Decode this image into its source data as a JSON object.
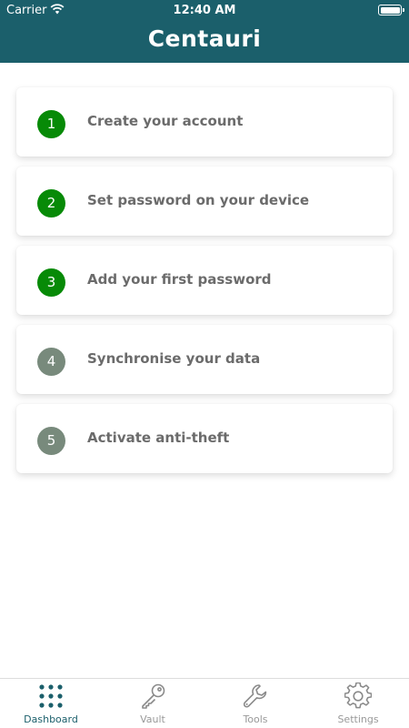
{
  "status_bar": {
    "carrier": "Carrier",
    "time": "12:40 AM"
  },
  "header": {
    "title": "Centauri"
  },
  "steps": [
    {
      "number": "1",
      "label": "Create your account",
      "completed": true
    },
    {
      "number": "2",
      "label": "Set password on your device",
      "completed": true
    },
    {
      "number": "3",
      "label": "Add your first password",
      "completed": true
    },
    {
      "number": "4",
      "label": "Synchronise your data",
      "completed": false
    },
    {
      "number": "5",
      "label": "Activate anti-theft",
      "completed": false
    }
  ],
  "tabs": [
    {
      "label": "Dashboard",
      "icon": "grid-icon",
      "active": true
    },
    {
      "label": "Vault",
      "icon": "key-icon",
      "active": false
    },
    {
      "label": "Tools",
      "icon": "wrench-icon",
      "active": false
    },
    {
      "label": "Settings",
      "icon": "gear-icon",
      "active": false
    }
  ],
  "colors": {
    "header": "#1b5f6b",
    "step_done": "#078a07",
    "step_pending": "#788a7c",
    "tab_active": "#1b5f6b",
    "tab_inactive": "#999999"
  }
}
